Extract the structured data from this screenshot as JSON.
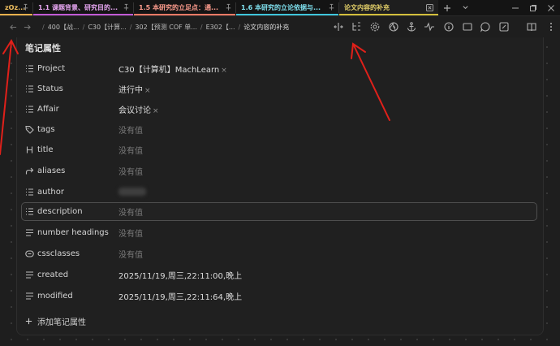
{
  "tabs": [
    {
      "label": "zOz...",
      "color": "#e8b04c",
      "pinned": true
    },
    {
      "label": "1.1 课题背景、研究目的...",
      "color": "#d06ae0",
      "pinned": true
    },
    {
      "label": "1.5 本研究的立足点：通...",
      "color": "#ff8a7a",
      "pinned": true
    },
    {
      "label": "1.6 本研究的立论依据与...",
      "color": "#4fd0e4",
      "pinned": true
    },
    {
      "label": "论文内容的补充",
      "color": "#e0c948",
      "pinned": false
    }
  ],
  "breadcrumb": [
    "400【战...",
    "C30【计算...",
    "302【预测 COF 单...",
    "E302【...",
    "论文内容的补充"
  ],
  "properties": {
    "title": "笔记属性",
    "rows": [
      {
        "key": "Project",
        "value": "C30【计算机】MachLearn",
        "icon": "list-icon",
        "has_remove": true
      },
      {
        "key": "Status",
        "value": "进行中",
        "icon": "list-icon",
        "has_remove": true
      },
      {
        "key": "Affair",
        "value": "会议讨论",
        "icon": "list-icon",
        "has_remove": true
      },
      {
        "key": "tags",
        "value": "没有值",
        "icon": "tag-icon",
        "empty": true
      },
      {
        "key": "title",
        "value": "没有值",
        "icon": "heading-icon",
        "empty": true
      },
      {
        "key": "aliases",
        "value": "没有值",
        "icon": "forward-arrow-icon",
        "empty": true
      },
      {
        "key": "author",
        "value": "",
        "icon": "list-icon",
        "blurred": true
      },
      {
        "key": "description",
        "value": "没有值",
        "icon": "list-icon",
        "empty": true,
        "active": true
      },
      {
        "key": "number headings",
        "value": "没有值",
        "icon": "text-lines-icon",
        "empty": true
      },
      {
        "key": "cssclasses",
        "value": "没有值",
        "icon": "css-icon",
        "empty": true
      },
      {
        "key": "created",
        "value": "2025/11/19,周三,22:11:00,晚上",
        "icon": "text-lines-icon"
      },
      {
        "key": "modified",
        "value": "2025/11/19,周三,22:11:64,晚上",
        "icon": "text-lines-icon"
      }
    ],
    "add_label": "添加笔记属性",
    "remove_glyph": "×"
  },
  "colors": {
    "annotation_arrow": "#e0201a",
    "accent": "#a57bff"
  }
}
